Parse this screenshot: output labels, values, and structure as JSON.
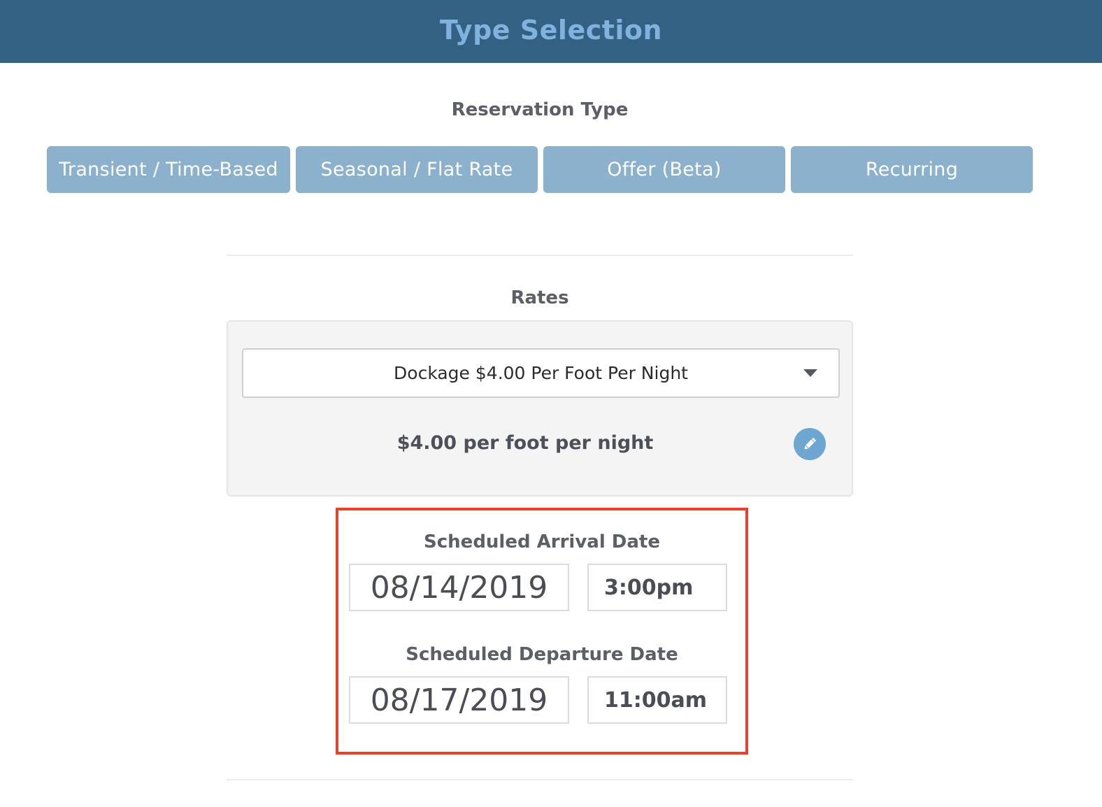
{
  "header": {
    "title": "Type Selection"
  },
  "reservation_type": {
    "label": "Reservation Type",
    "options": [
      {
        "label": "Transient / Time-Based"
      },
      {
        "label": "Seasonal / Flat Rate"
      },
      {
        "label": "Offer (Beta)"
      },
      {
        "label": "Recurring"
      }
    ]
  },
  "rates": {
    "label": "Rates",
    "selected_rate": "Dockage $4.00 Per Foot Per Night",
    "summary": "$4.00 per foot per night",
    "edit_icon": "pencil-icon",
    "dropdown_icon": "caret-down-icon"
  },
  "schedule": {
    "arrival": {
      "label": "Scheduled Arrival Date",
      "date": "08/14/2019",
      "time": "3:00pm"
    },
    "departure": {
      "label": "Scheduled Departure Date",
      "date": "08/17/2019",
      "time": "11:00am"
    }
  },
  "colors": {
    "header_bg": "#336183",
    "header_text": "#7fb2de",
    "type_button_bg": "#8bb1cc",
    "edit_button_bg": "#6ea6d2",
    "highlight_border": "#e8422f"
  }
}
